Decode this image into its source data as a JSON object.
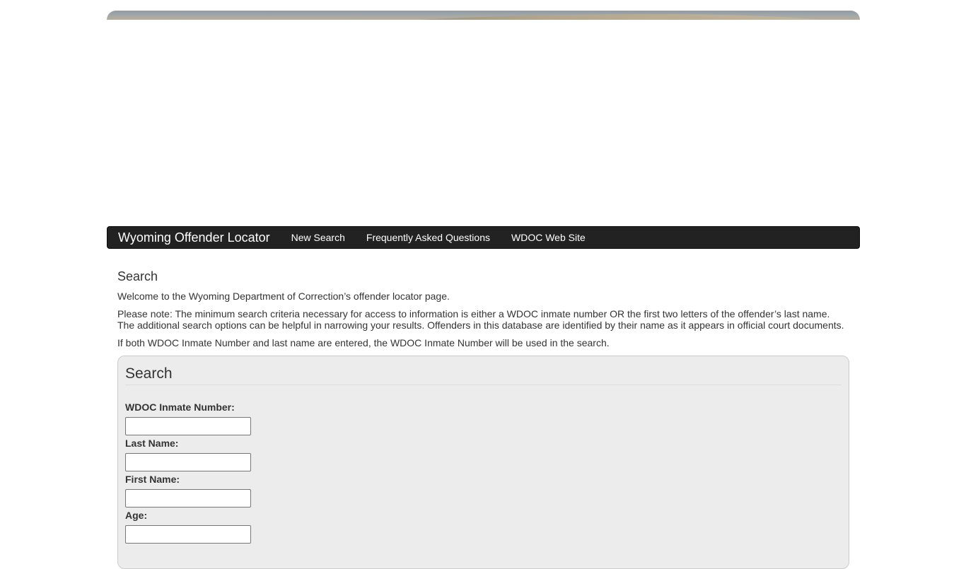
{
  "navbar": {
    "brand": "Wyoming Offender Locator",
    "links": [
      "New Search",
      "Frequently Asked Questions",
      "WDOC Web Site"
    ]
  },
  "main": {
    "heading": "Search",
    "welcome": "Welcome to the Wyoming Department of Correction’s offender locator page.",
    "note_line1": "Please note: The minimum search criteria necessary for access to information is either a WDOC inmate number OR the first two letters of the offender’s last name.",
    "note_line2": "The additional search options can be helpful in narrowing your results. Offenders in this database are identified by their name as it appears in official court documents.",
    "priority": "If both WDOC Inmate Number and last name are entered, the WDOC Inmate Number will be used in the search."
  },
  "search_panel": {
    "title": "Search",
    "fields": [
      {
        "label": "WDOC Inmate Number:",
        "value": ""
      },
      {
        "label": "Last Name:",
        "value": ""
      },
      {
        "label": "First Name:",
        "value": ""
      },
      {
        "label": "Age:",
        "value": ""
      }
    ]
  },
  "colors": {
    "navbar_bg": "#222222",
    "panel_bg": "#ececec",
    "text": "#333333"
  }
}
